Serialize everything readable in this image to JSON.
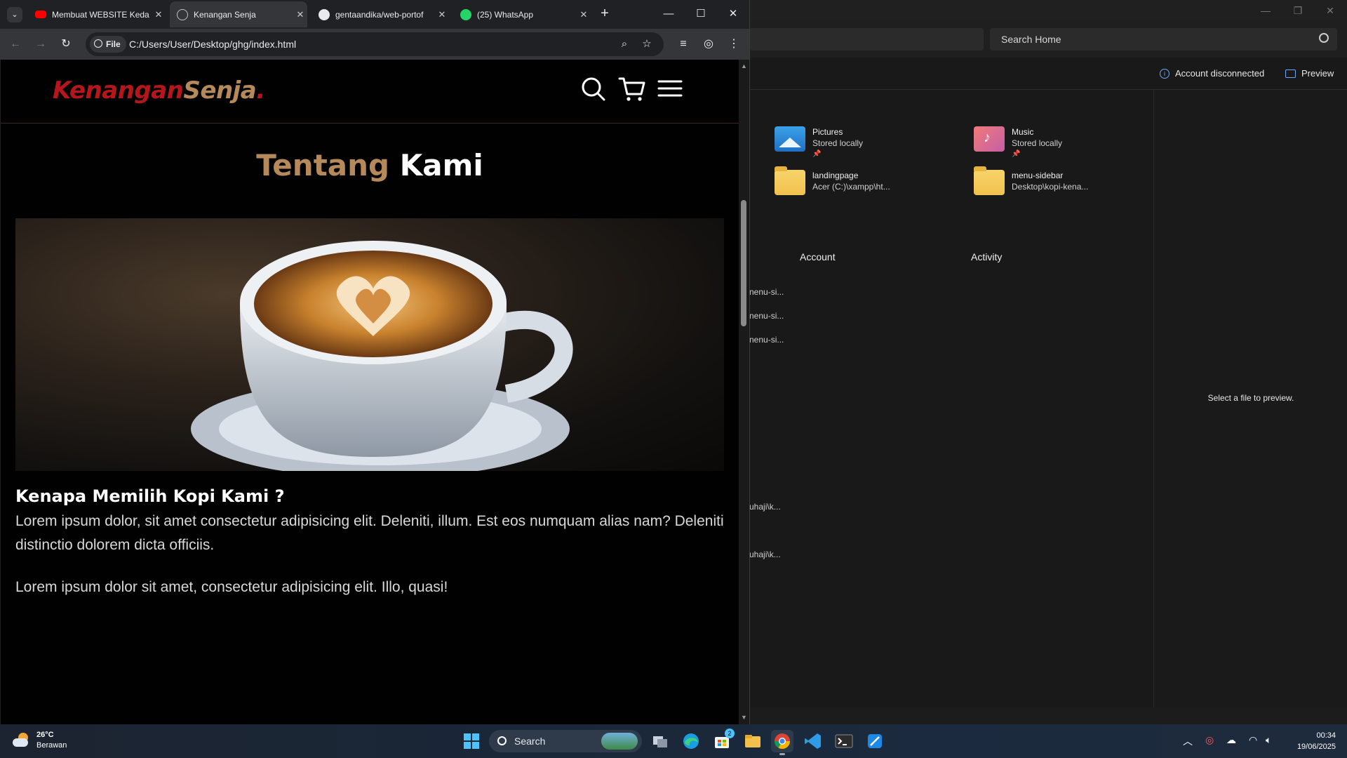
{
  "explorer": {
    "search_placeholder": "Search Home",
    "account_status": "Account disconnected",
    "preview_label": "Preview",
    "preview_hint": "Select a file to preview.",
    "quick_access": [
      {
        "name": "Pictures",
        "sub": "Stored locally",
        "icon": "pictures-folder-icon"
      },
      {
        "name": "Music",
        "sub": "Stored locally",
        "icon": "music-folder-icon"
      },
      {
        "name": "landingpage",
        "sub": "Acer (C:)\\xampp\\ht...",
        "icon": "folder-icon"
      },
      {
        "name": "menu-sidebar",
        "sub": "Desktop\\kopi-kena...",
        "icon": "folder-icon"
      }
    ],
    "columns": {
      "account": "Account",
      "activity": "Activity"
    },
    "recent_fragments": [
      "nenu-si...",
      "nenu-si...",
      "nenu-si...",
      "uhaji\\k...",
      "uhaji\\k..."
    ]
  },
  "chrome": {
    "tabs": [
      {
        "title": "Membuat WEBSITE Keda",
        "icon": "youtube-icon",
        "active": false
      },
      {
        "title": "Kenangan Senja",
        "icon": "globe-icon",
        "active": true
      },
      {
        "title": "gentaandika/web-portof",
        "icon": "github-icon",
        "active": false
      },
      {
        "title": "(25) WhatsApp",
        "icon": "whatsapp-icon",
        "active": false
      }
    ],
    "new_tab": "+",
    "scheme_chip": "File",
    "url": "C:/Users/User/Desktop/ghg/index.html"
  },
  "site": {
    "logo": {
      "part1": "Kenangan",
      "part2": "Senja",
      "part3": "."
    },
    "heading": {
      "part1": "Tentang",
      "part2": "Kami"
    },
    "subheading": "Kenapa Memilih Kopi Kami ?",
    "paragraphs": [
      "Lorem ipsum dolor, sit amet consectetur adipisicing elit. Deleniti, illum. Est eos numquam alias nam? Deleniti distinctio dolorem dicta officiis.",
      "Lorem ipsum dolor sit amet, consectetur adipisicing elit. Illo, quasi!"
    ],
    "colors": {
      "primary": "#b6895b",
      "accent": "#b6151c",
      "bg": "#010101"
    }
  },
  "taskbar": {
    "weather_temp": "26°C",
    "weather_desc": "Berawan",
    "search_label": "Search",
    "time": "00:34",
    "date": "19/06/2025",
    "store_badge": "2"
  }
}
